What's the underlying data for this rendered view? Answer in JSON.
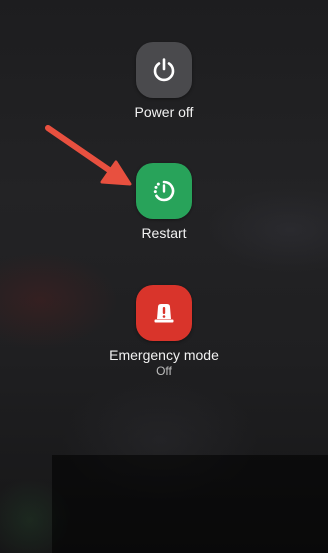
{
  "menu": {
    "power_off": {
      "label": "Power off",
      "icon": "power-icon",
      "color": "#4a4a4d"
    },
    "restart": {
      "label": "Restart",
      "icon": "restart-icon",
      "color": "#28a35a"
    },
    "emergency": {
      "label": "Emergency mode",
      "status": "Off",
      "icon": "emergency-icon",
      "color": "#d9342b"
    }
  },
  "annotation": {
    "icon": "arrow-icon",
    "color": "#e8503f"
  }
}
